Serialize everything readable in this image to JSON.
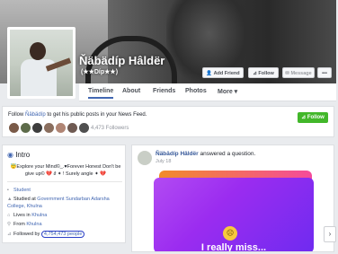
{
  "profile": {
    "name": "Ňäbädíp Hâldër",
    "subtitle": "(★★Díp★★)"
  },
  "actions": {
    "add_friend": "Add Friend",
    "follow": "Follow",
    "message": "Message",
    "more": "•••"
  },
  "nav": {
    "tabs": [
      "Timeline",
      "About",
      "Friends",
      "Photos",
      "More ▾"
    ]
  },
  "follow_bar": {
    "prefix": "Follow ",
    "name_link": "Ňäbädíp",
    "suffix": " to get his public posts in your News Feed.",
    "button": "Follow",
    "followers": "4,473 Followers"
  },
  "intro": {
    "title": "Intro",
    "quote": "😇Explore your Mind©_.♥Forever Honest Don't be give up© 💔 ∂ ✦ ! Surely angle ✦ 💔",
    "rows": [
      {
        "icon": "briefcase",
        "pre": "",
        "link": "Student",
        "post": ""
      },
      {
        "icon": "grad-cap",
        "pre": "Studied at ",
        "link": "Government Sundarban Adarsha College, Khulna",
        "post": ""
      },
      {
        "icon": "home",
        "pre": "Lives in ",
        "link": "Khulna",
        "post": ""
      },
      {
        "icon": "pin",
        "pre": "From ",
        "link": "Khulna",
        "post": ""
      },
      {
        "icon": "rss",
        "pre": "Followed by ",
        "link": "4,754,473 people",
        "post": ""
      }
    ]
  },
  "post": {
    "author": "Ňäbädíp Hâldër",
    "action": " answered a question.",
    "date": "July 18",
    "card_text": "I really miss..."
  },
  "colors": {
    "facebook_blue": "#4267b2",
    "green": "#42b72a"
  }
}
